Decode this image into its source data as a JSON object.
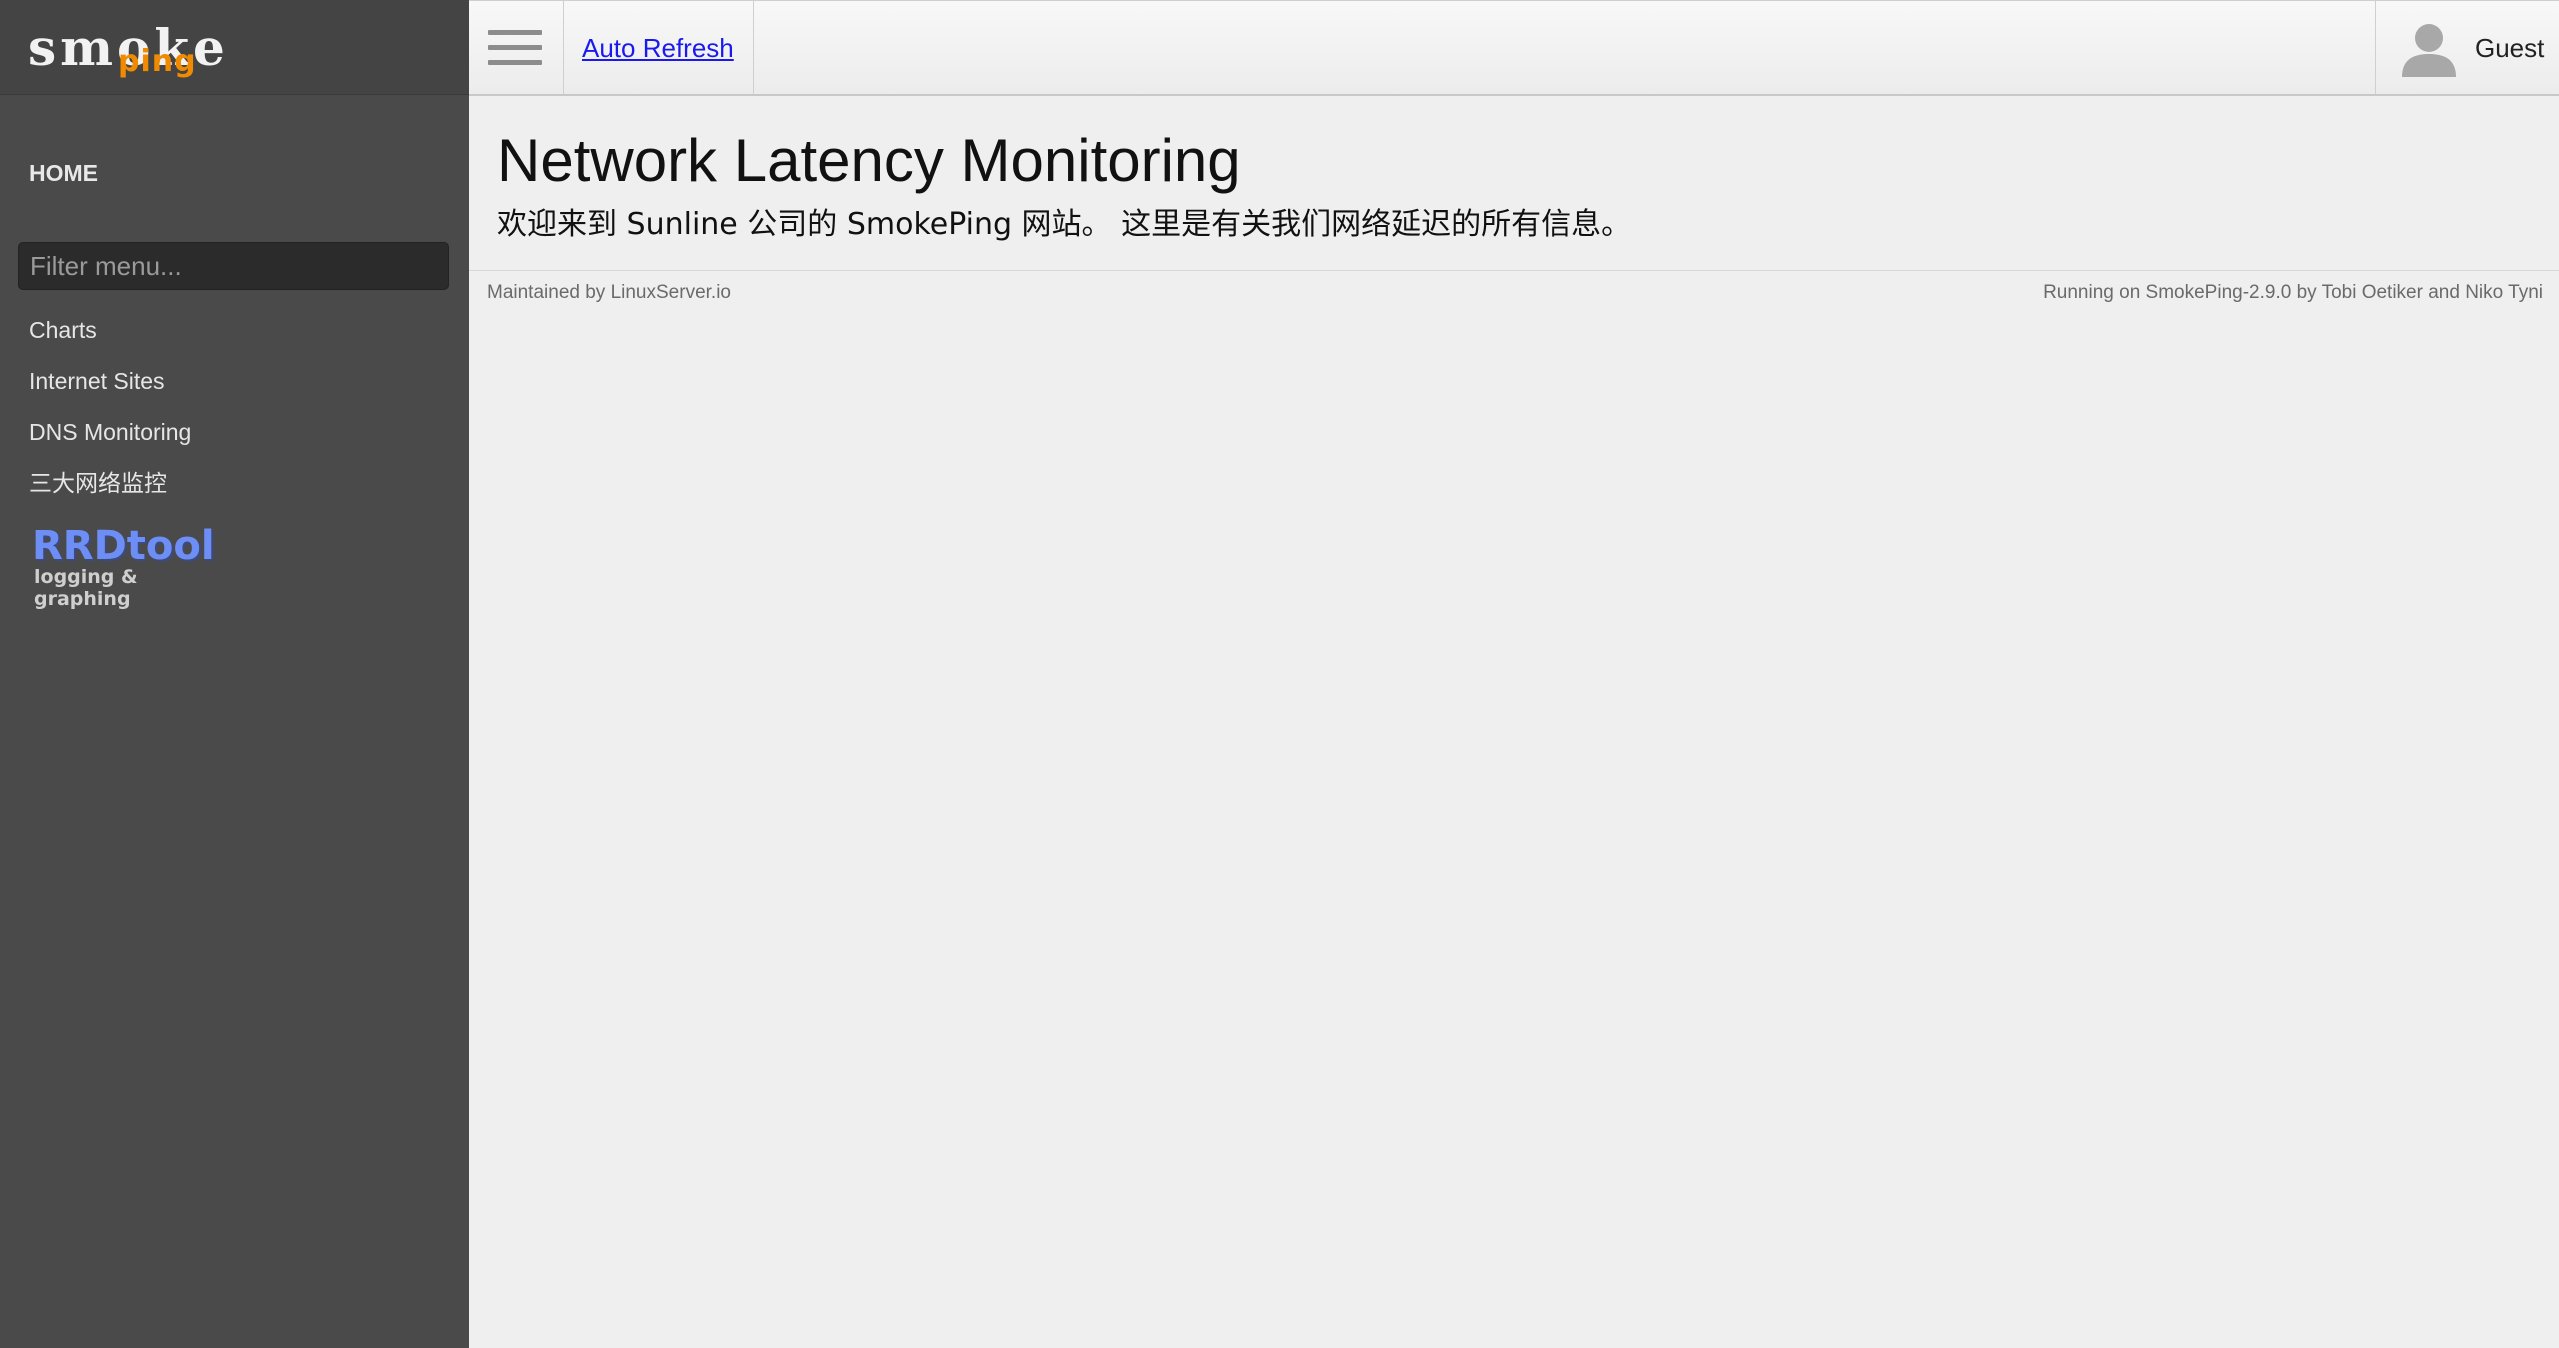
{
  "sidebar": {
    "logo": {
      "word": "smoke",
      "sub": "ping"
    },
    "home_label": "HOME",
    "filter_placeholder": "Filter menu...",
    "items": [
      {
        "label": "Charts"
      },
      {
        "label": "Internet Sites"
      },
      {
        "label": "DNS Monitoring"
      },
      {
        "label": "三大网络监控"
      }
    ],
    "rrdtool": {
      "title": "RRDtool",
      "tagline": "logging & graphing"
    }
  },
  "topbar": {
    "menu_icon": "hamburger-icon",
    "auto_refresh_label": "Auto Refresh",
    "user_icon": "user-avatar-icon",
    "user_name": "Guest"
  },
  "main": {
    "title": "Network Latency Monitoring",
    "subtitle": "欢迎来到 Sunline 公司的 SmokePing 网站。 这里是有关我们网络延迟的所有信息。"
  },
  "footer": {
    "left": "Maintained by LinuxServer.io",
    "right": "Running on SmokePing-2.9.0 by Tobi Oetiker and Niko Tyni"
  },
  "colors": {
    "sidebar_bg": "#4a4a4a",
    "logo_accent": "#f08a00",
    "link": "#1a1aee",
    "rrdtool_blue": "#6d8ff5"
  }
}
